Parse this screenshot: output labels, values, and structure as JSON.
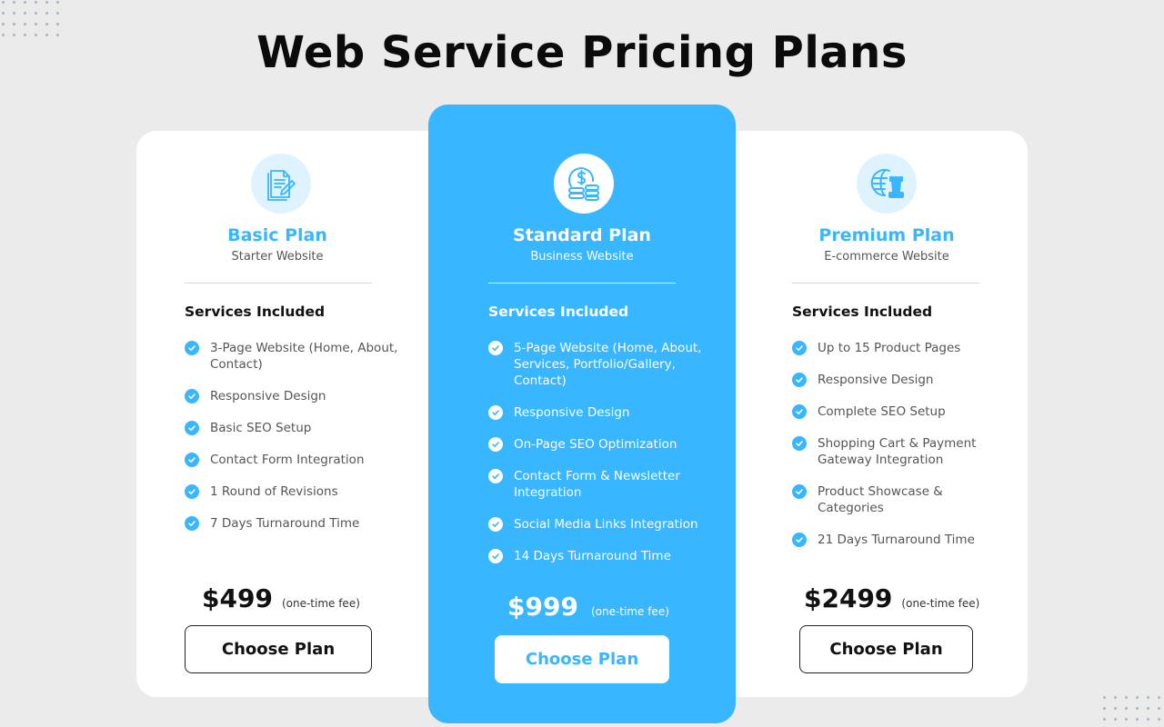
{
  "title": "Web Service Pricing Plans",
  "colors": {
    "accent": "#38b6ff",
    "background": "#ebebeb",
    "card": "#ffffff",
    "icon_bg": "#dff3ff",
    "text_dark": "#111111",
    "text_muted": "#555555"
  },
  "plans": [
    {
      "icon": "document-edit-icon",
      "name": "Basic Plan",
      "subtitle": "Starter Website",
      "section_heading": "Services Included",
      "features": [
        "3-Page Website (Home, About, Contact)",
        "Responsive Design",
        "Basic SEO Setup",
        "Contact Form Integration",
        "1 Round of Revisions",
        "7 Days Turnaround Time"
      ],
      "price": "$499",
      "price_note": "(one-time fee)",
      "button_label": "Choose Plan"
    },
    {
      "icon": "dollar-coins-icon",
      "name": "Standard Plan",
      "subtitle": "Business Website",
      "section_heading": "Services Included",
      "features": [
        "5-Page Website (Home, About, Services, Portfolio/Gallery, Contact)",
        "Responsive Design",
        "On-Page SEO Optimization",
        "Contact Form & Newsletter Integration",
        "Social Media Links Integration",
        "14 Days Turnaround Time"
      ],
      "price": "$999",
      "price_note": "(one-time fee)",
      "button_label": "Choose Plan"
    },
    {
      "icon": "globe-strategy-icon",
      "name": "Premium Plan",
      "subtitle": "E-commerce Website",
      "section_heading": "Services Included",
      "features": [
        "Up to 15 Product Pages",
        "Responsive Design",
        "Complete SEO Setup",
        "Shopping Cart & Payment Gateway Integration",
        "Product Showcase & Categories",
        "21 Days Turnaround Time"
      ],
      "price": "$2499",
      "price_note": "(one-time fee)",
      "button_label": "Choose Plan"
    }
  ]
}
